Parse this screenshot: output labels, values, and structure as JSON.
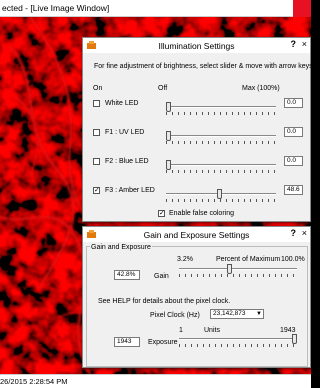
{
  "window": {
    "title": "ected - [Live Image Window]"
  },
  "status": {
    "timestamp": "26/2015 2:28:54 PM"
  },
  "illumination": {
    "title": "Illumination Settings",
    "help": "?",
    "close": "×",
    "instructions": "For fine adjustment of brightness, select slider & move with arrow keys.",
    "col_on": "On",
    "col_off": "Off",
    "col_max": "Max (100%)",
    "leds": [
      {
        "label": "White LED",
        "checked": false,
        "value": "0.0",
        "level": 0
      },
      {
        "label": "F1 : UV LED",
        "checked": false,
        "value": "0.0",
        "level": 0
      },
      {
        "label": "F2 : Blue LED",
        "checked": false,
        "value": "0.0",
        "level": 0
      },
      {
        "label": "F3 : Amber LED",
        "checked": true,
        "value": "48.6",
        "level": 0.486
      }
    ],
    "false_color_label": "Enable false coloring",
    "false_color_checked": true
  },
  "gain_exposure": {
    "title": "Gain and Exposure Settings",
    "help": "?",
    "close": "×",
    "group_label": "Gain and Exposure",
    "pct_min": "3.2%",
    "pct_caption": "Percent of Maximum",
    "pct_max": "100.0%",
    "gain_value": "42.8%",
    "gain_label": "Gain",
    "gain_level": 0.428,
    "help_text": "See HELP for details about the pixel clock.",
    "pixel_clock_label": "Pixel Clock (Hz)",
    "pixel_clock_value": "23,142,873",
    "units_min": "1",
    "units_caption": "Units",
    "units_max": "1943",
    "exposure_value": "1943",
    "exposure_label": "Exposure",
    "exposure_level": 1.0
  },
  "colors": {
    "accent_close": "#e81123",
    "dialog_bg": "#f0f0f0",
    "image_red": "#cc0000"
  }
}
